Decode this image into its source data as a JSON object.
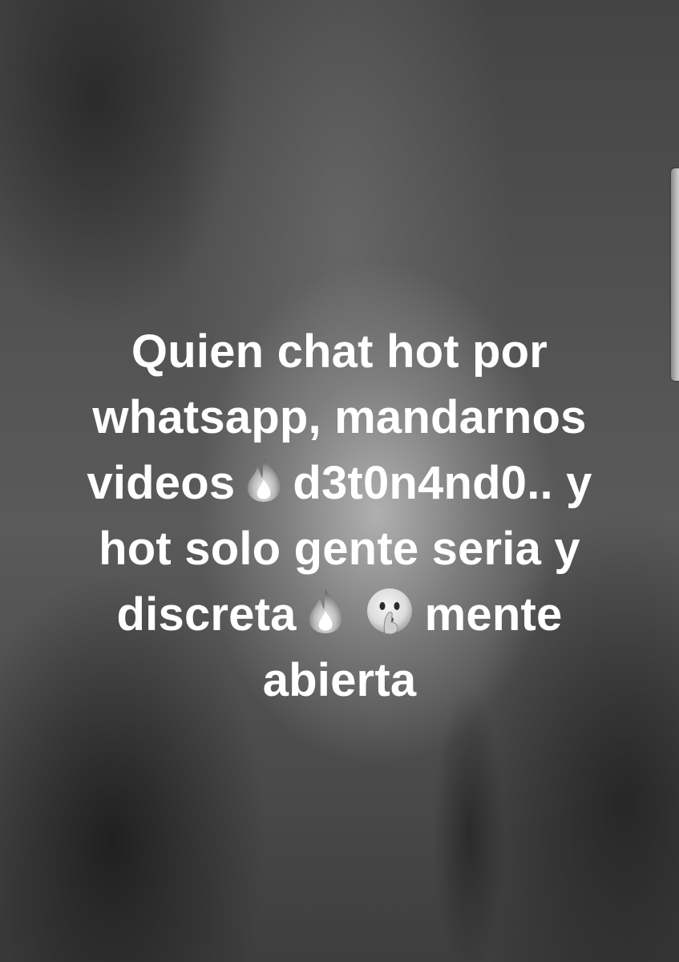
{
  "story": {
    "line1": "Quien chat hot por",
    "line2": "whatsapp, mandarnos",
    "line3_a": "videos",
    "line3_b": "d3t0n4nd0.. y",
    "line4": "hot solo gente seria y",
    "line5_a": "discreta",
    "line5_b": "mente",
    "line6": "abierta"
  },
  "icons": {
    "fire": "fire-emoji",
    "shush": "shushing-face-emoji"
  },
  "colors": {
    "text": "#ffffff",
    "background": "#4a4a4a"
  }
}
